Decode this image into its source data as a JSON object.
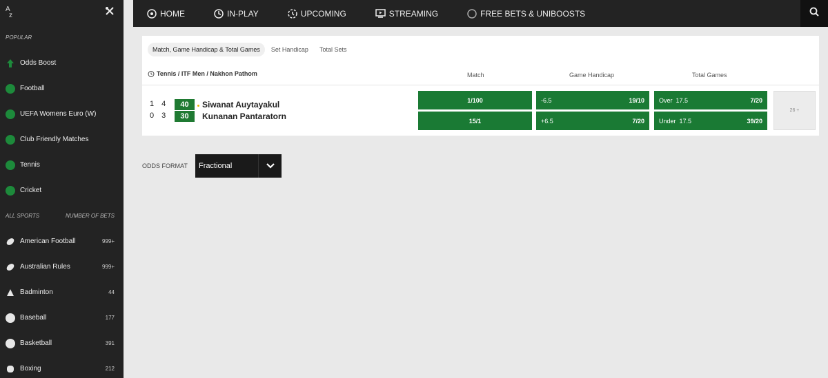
{
  "sidebar": {
    "popular_heading": "POPULAR",
    "popular": [
      {
        "label": "Odds Boost",
        "icon": "odds-boost-icon"
      },
      {
        "label": "Football",
        "icon": "football-icon"
      },
      {
        "label": "UEFA Womens Euro (W)",
        "icon": "football-icon"
      },
      {
        "label": "Club Friendly Matches",
        "icon": "football-icon"
      },
      {
        "label": "Tennis",
        "icon": "tennis-icon"
      },
      {
        "label": "Cricket",
        "icon": "cricket-icon"
      }
    ],
    "all_sports_heading": "ALL SPORTS",
    "number_of_bets_heading": "NUMBER OF BETS",
    "sports": [
      {
        "label": "American Football",
        "count": "999+",
        "icon": "american-football-icon"
      },
      {
        "label": "Australian Rules",
        "count": "999+",
        "icon": "australian-rules-icon"
      },
      {
        "label": "Badminton",
        "count": "44",
        "icon": "shuttlecock-icon"
      },
      {
        "label": "Baseball",
        "count": "177",
        "icon": "baseball-icon"
      },
      {
        "label": "Basketball",
        "count": "391",
        "icon": "basketball-icon"
      },
      {
        "label": "Boxing",
        "count": "212",
        "icon": "boxing-glove-icon"
      }
    ]
  },
  "nav": {
    "items": [
      {
        "label": "HOME",
        "icon": "home-icon"
      },
      {
        "label": "IN-PLAY",
        "icon": "clock-icon"
      },
      {
        "label": "UPCOMING",
        "icon": "upcoming-icon"
      },
      {
        "label": "STREAMING",
        "icon": "tv-icon"
      },
      {
        "label": "FREE BETS & UNIBOOSTS",
        "icon": "circle-icon"
      }
    ]
  },
  "market_tabs": [
    "Match, Game Handicap & Total Games",
    "Set Handicap",
    "Total Sets"
  ],
  "event": {
    "competition": "Tennis / ITF Men / Nakhon Pathom",
    "columns": [
      "Match",
      "Game Handicap",
      "Total Games"
    ],
    "players": [
      {
        "name": "Siwanat Auytayakul",
        "sets": "1 4",
        "game": "40"
      },
      {
        "name": "Kunanan Pantaratorn",
        "sets": "0 3",
        "game": "30"
      }
    ],
    "match_odds": [
      "1/100",
      "15/1"
    ],
    "handicap": [
      {
        "line": "-6.5",
        "price": "19/10"
      },
      {
        "line": "+6.5",
        "price": "7/20"
      }
    ],
    "totals": [
      {
        "line": "Over  17.5",
        "price": "7/20"
      },
      {
        "line": "Under  17.5",
        "price": "39/20"
      }
    ],
    "more_markets": "26 +"
  },
  "odds_format": {
    "label": "ODDS FORMAT",
    "value": "Fractional"
  },
  "colors": {
    "odds_green": "#1a7a34",
    "sidebar_bg": "#232323"
  }
}
